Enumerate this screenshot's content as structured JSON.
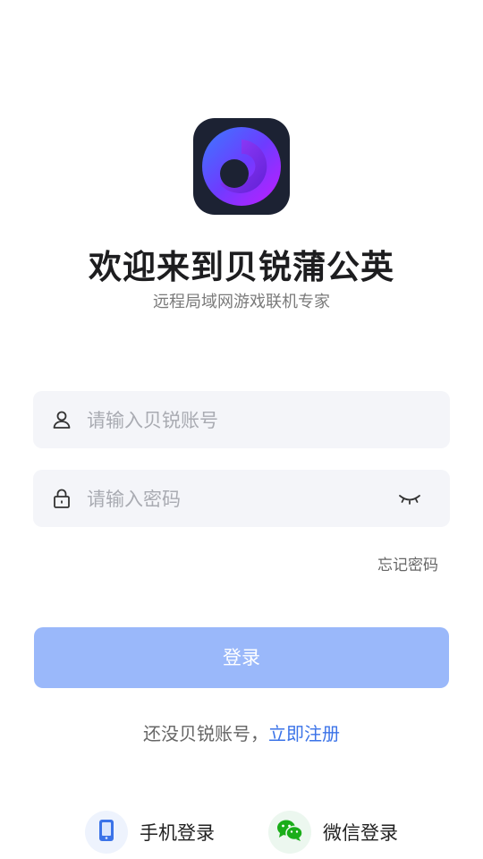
{
  "header": {
    "title": "欢迎来到贝锐蒲公英",
    "subtitle": "远程局域网游戏联机专家"
  },
  "form": {
    "account_placeholder": "请输入贝锐账号",
    "password_placeholder": "请输入密码",
    "forgot_label": "忘记密码",
    "login_label": "登录"
  },
  "register": {
    "prompt": "还没贝锐账号，",
    "link": "立即注册"
  },
  "alt_login": {
    "phone_label": "手机登录",
    "wechat_label": "微信登录"
  },
  "colors": {
    "accent": "#3b73e8",
    "login_button": "#9ab8fa",
    "field_bg": "#f4f5f9",
    "wechat_green": "#1aad19"
  },
  "icons": {
    "account": "user-icon",
    "password": "lock-icon",
    "visibility": "eye-closed-icon",
    "phone": "phone-icon",
    "wechat": "wechat-icon"
  }
}
